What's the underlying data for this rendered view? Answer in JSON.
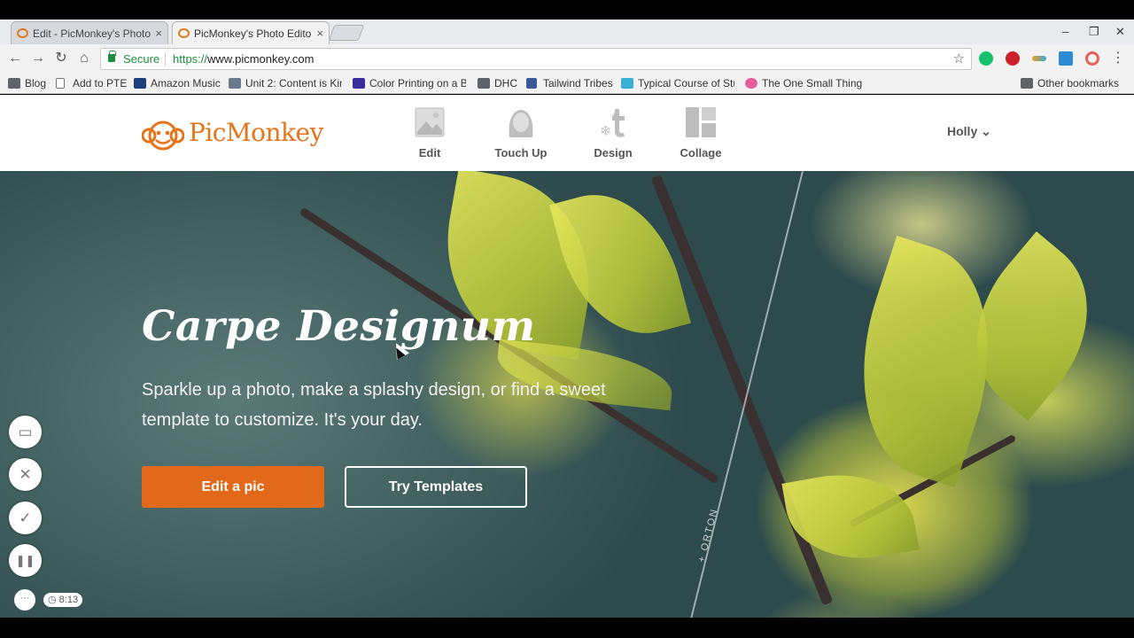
{
  "browser": {
    "tabs": [
      {
        "title": "Edit - PicMonkey's Photo",
        "state": "inactive"
      },
      {
        "title": "PicMonkey's Photo Edito",
        "state": "active"
      }
    ],
    "tab_close_glyph": "×",
    "window_controls": [
      "–",
      "❐",
      "✕"
    ],
    "address": {
      "secure_label": "Secure",
      "scheme": "https://",
      "host": "www.picmonkey.com"
    },
    "bookmarks": [
      {
        "label": "Blog",
        "icon": "folder-icon"
      },
      {
        "label": "Add to PTE",
        "icon": "page-icon"
      },
      {
        "label": "Amazon Music",
        "icon": "amazon-music-icon"
      },
      {
        "label": "Unit 2: Content is Kin",
        "icon": "page-icon"
      },
      {
        "label": "Color Printing on a B",
        "icon": "page-icon"
      },
      {
        "label": "DHC",
        "icon": "folder-icon"
      },
      {
        "label": "Tailwind Tribes",
        "icon": "facebook-icon"
      },
      {
        "label": "Typical Course of Stu",
        "icon": "page-icon"
      },
      {
        "label": "The One Small Thing",
        "icon": "page-icon"
      },
      {
        "label": "Other bookmarks",
        "icon": "folder-icon"
      }
    ]
  },
  "site": {
    "brand": "PicMonkey",
    "nav": [
      {
        "label": "Edit",
        "icon": "image-icon"
      },
      {
        "label": "Touch Up",
        "icon": "face-icon"
      },
      {
        "label": "Design",
        "icon": "design-icon"
      },
      {
        "label": "Collage",
        "icon": "collage-icon"
      }
    ],
    "user_name": "Holly",
    "user_chevron": "⌄",
    "accent_color": "#e3691a"
  },
  "hero": {
    "title": "Carpe Designum",
    "subtitle": "Sparkle up a photo, make a splashy design, or find a sweet template to customize. It's your day.",
    "primary_button": "Edit a pic",
    "secondary_button": "Try Templates",
    "photo_credit": "+ ORTON"
  },
  "recorder": {
    "buttons": [
      {
        "name": "camera-off-icon",
        "glyph": "▭"
      },
      {
        "name": "close-icon",
        "glyph": "✕"
      },
      {
        "name": "check-icon",
        "glyph": "✓"
      },
      {
        "name": "pause-icon",
        "glyph": "❚❚"
      }
    ],
    "more_glyph": "···",
    "timer": "8:13"
  }
}
